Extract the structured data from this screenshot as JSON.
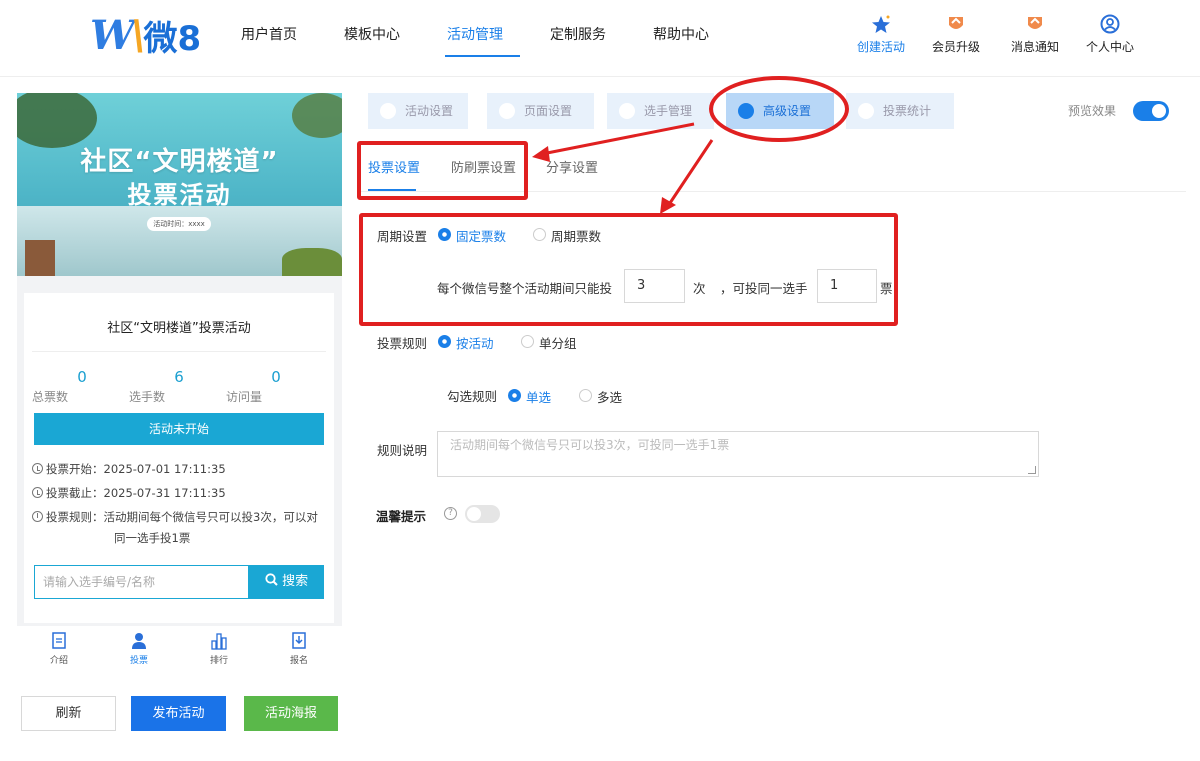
{
  "brand": {
    "logo_text": "微8",
    "logo_mark": "W"
  },
  "nav": {
    "items": [
      "用户首页",
      "模板中心",
      "活动管理",
      "定制服务",
      "帮助中心"
    ],
    "active": "活动管理",
    "icons": [
      {
        "label": "创建活动",
        "icon": "star-icon"
      },
      {
        "label": "会员升级",
        "icon": "badge-icon"
      },
      {
        "label": "消息通知",
        "icon": "bell-icon"
      },
      {
        "label": "个人中心",
        "icon": "user-circle-icon"
      }
    ]
  },
  "preview": {
    "banner": {
      "title_line1": "社区“文明楼道”",
      "title_line2": "投票活动",
      "time_pill": "活动时间：xxxx"
    },
    "card_title": "社区“文明楼道”投票活动",
    "stats": [
      {
        "value": "0",
        "label": "总票数"
      },
      {
        "value": "6",
        "label": "选手数"
      },
      {
        "value": "0",
        "label": "访问量"
      }
    ],
    "status": "活动未开始",
    "vote_start": "投票开始：2025-07-01 17:11:35",
    "vote_end": "投票截止：2025-07-31 17:11:35",
    "vote_rule_line1": "投票规则：活动期间每个微信号只可以投3次，可以对",
    "vote_rule_line2": "同一选手投1票",
    "search_placeholder": "请输入选手编号/名称",
    "search_button": "搜索",
    "tabs": [
      "介绍",
      "投票",
      "排行",
      "报名"
    ],
    "active_tab": "投票"
  },
  "actions": {
    "refresh": "刷新",
    "publish": "发布活动",
    "poster": "活动海报"
  },
  "config": {
    "steps": [
      "活动设置",
      "页面设置",
      "选手管理",
      "高级设置",
      "投票统计"
    ],
    "active_step": "高级设置",
    "preview_label": "预览效果",
    "preview_toggle": true,
    "sub_tabs": [
      "投票设置",
      "防刷票设置",
      "分享设置"
    ],
    "active_sub_tab": "投票设置",
    "cycle": {
      "label": "周期设置",
      "options": [
        "固定票数",
        "周期票数"
      ],
      "selected": "固定票数",
      "text_before": "每个微信号整个活动期间只能投",
      "times_value": "3",
      "unit_times": "次",
      "text_mid": "，可投同一选手",
      "per_candidate_value": "1",
      "unit_votes": "票"
    },
    "rule": {
      "label": "投票规则",
      "options": [
        "按活动",
        "单分组"
      ],
      "selected": "按活动"
    },
    "check_rule": {
      "label": "勾选规则",
      "options": [
        "单选",
        "多选"
      ],
      "selected": "单选"
    },
    "description": {
      "label": "规则说明",
      "placeholder": "活动期间每个微信号只可以投3次，可投同一选手1票"
    },
    "tips": {
      "label": "温馨提示",
      "enabled": false
    }
  },
  "colors": {
    "accent": "#1a7fe8",
    "teal": "#1aa7d4",
    "green": "#5ab84a",
    "annotation": "#e02020"
  }
}
